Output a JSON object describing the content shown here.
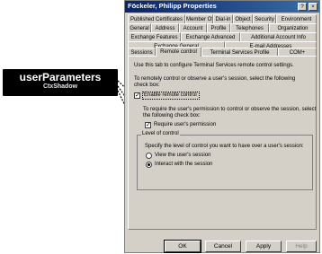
{
  "callout": {
    "title": "userParameters",
    "subtitle": "CtxShadow"
  },
  "window": {
    "title": "Föckeler, Philipp Properties",
    "help_button": "?",
    "close_button": "×"
  },
  "tabs": {
    "row1": [
      "Published Certificates",
      "Member Of",
      "Dial-in",
      "Object",
      "Security",
      "Environment"
    ],
    "row2": [
      "General",
      "Address",
      "Account",
      "Profile",
      "Telephones",
      "Organization"
    ],
    "row3": [
      "Exchange Features",
      "Exchange Advanced",
      "Additional Account Info"
    ],
    "row4": [
      "Exchange General",
      "E-mail Addresses"
    ],
    "row5": [
      "Sessions",
      "Remote control",
      "Terminal Services Profile",
      "COM+"
    ]
  },
  "panel": {
    "intro": "Use this tab to configure Terminal Services remote control settings.",
    "instruction_line1": "To remotely control or observe a user's session, select the following",
    "instruction_line2": "check box:",
    "enable_checkbox": {
      "label": "Enable remote control",
      "checked": true
    },
    "permission_line1": "To require the user's permission to control or observe the session, select",
    "permission_line2": "the following check box:",
    "permission_checkbox": {
      "label": "Require user's permission",
      "checked": true
    },
    "group_title": "Level of control",
    "group_desc": "Specify the level of control you want to have over a user's session:",
    "radio_view": {
      "label": "View the user's session",
      "selected": false
    },
    "radio_interact": {
      "label": "Interact with the session",
      "selected": true
    }
  },
  "buttons": {
    "ok": "OK",
    "cancel": "Cancel",
    "apply": "Apply",
    "help": "Help"
  }
}
